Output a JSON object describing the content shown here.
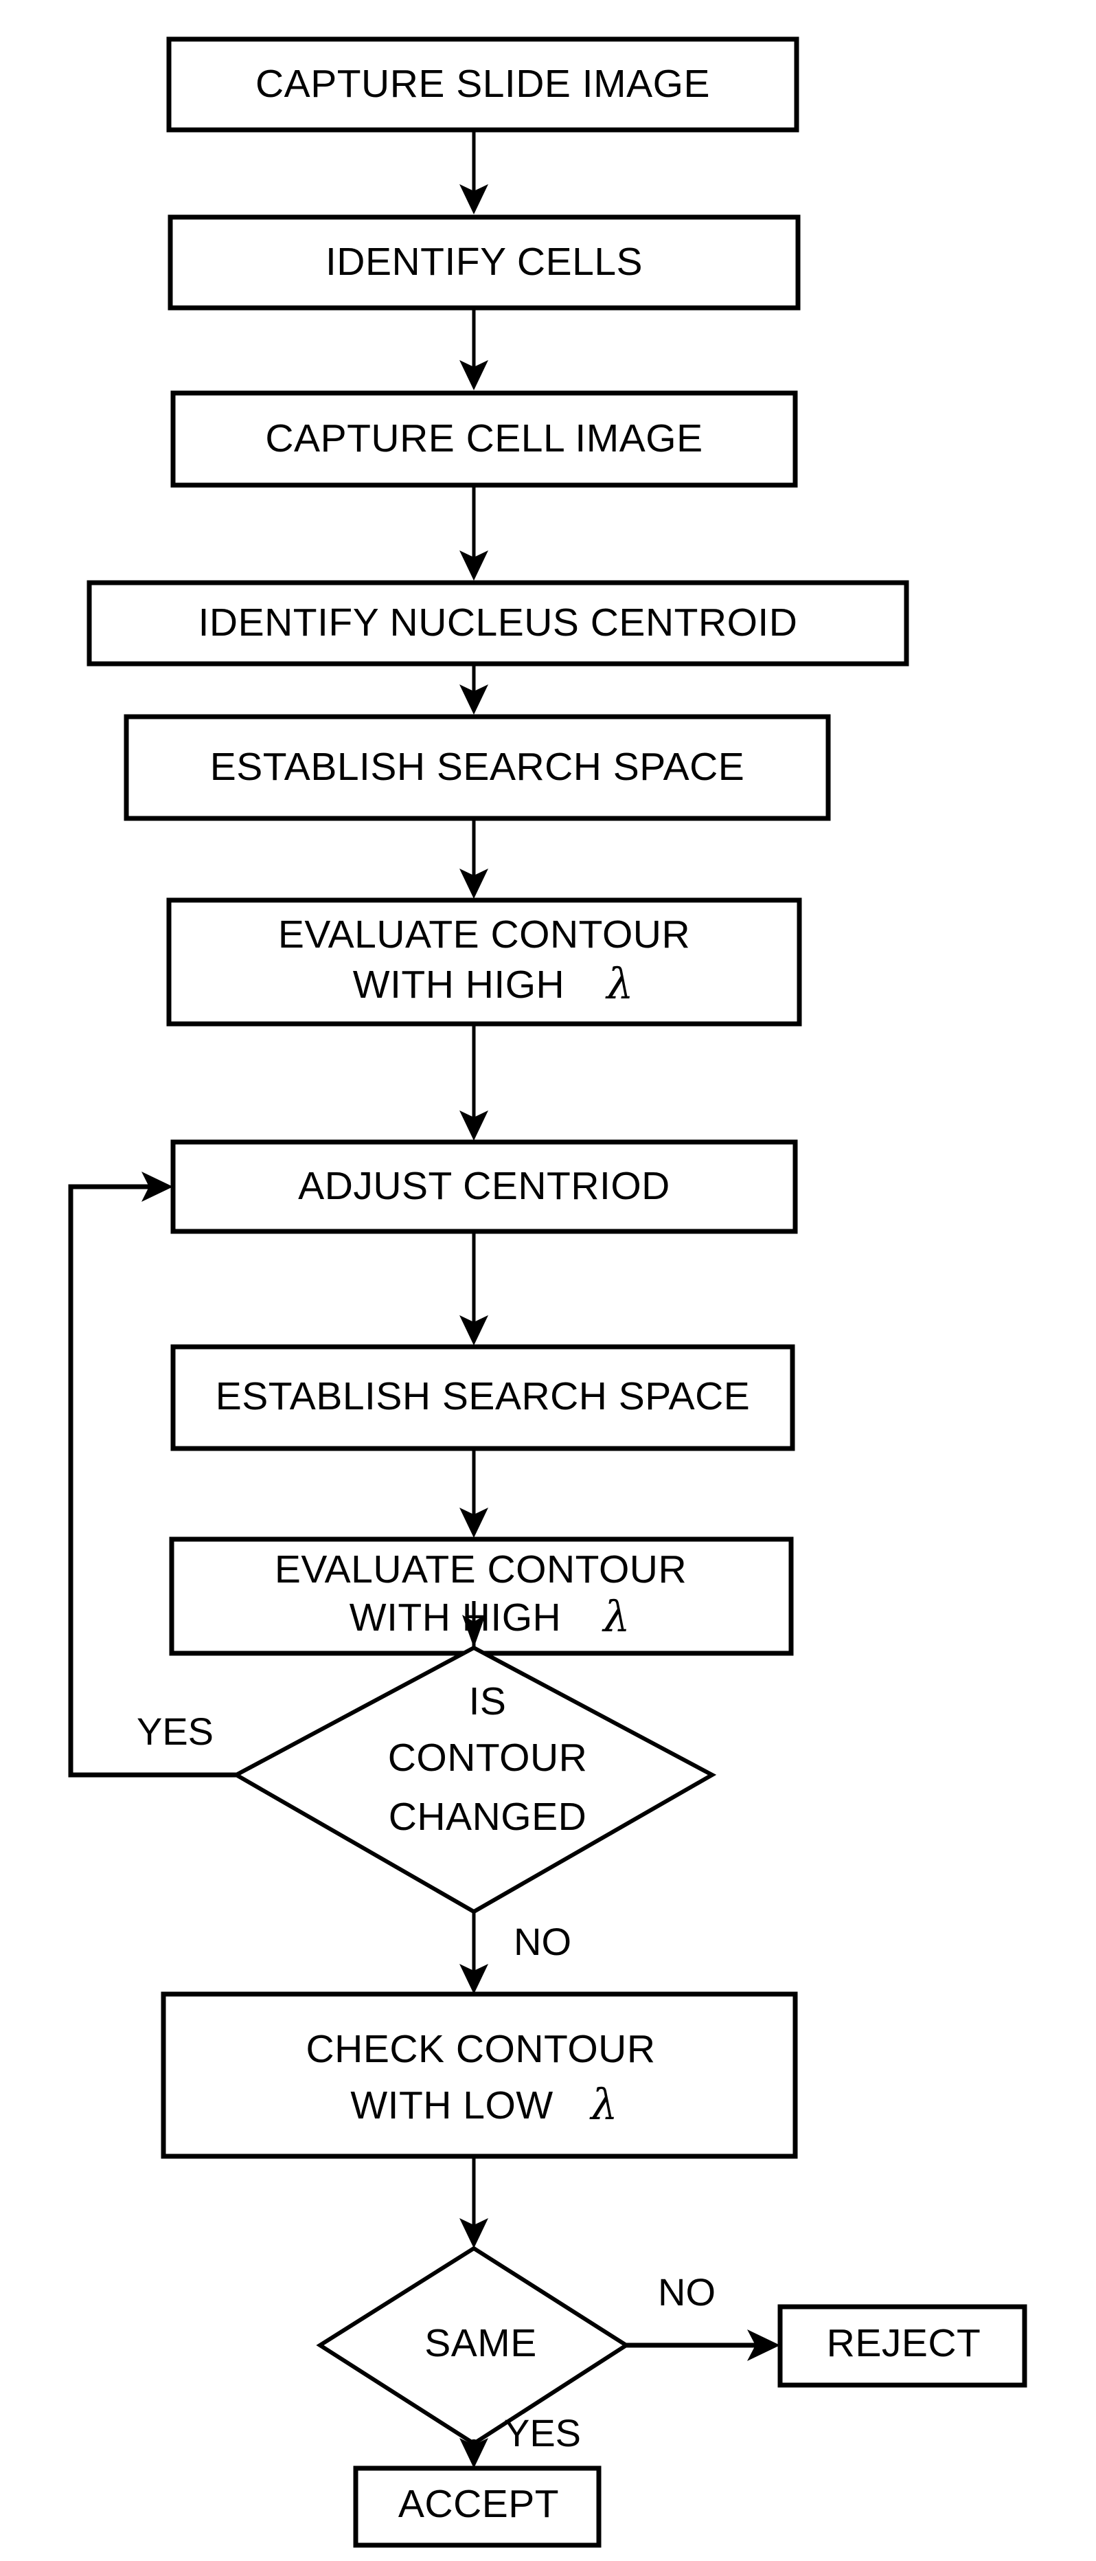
{
  "diagram": {
    "type": "flowchart",
    "title": "",
    "orientation": "top-to-bottom",
    "colors": {
      "background": "#ffffff",
      "stroke": "#000000",
      "fill": "#ffffff",
      "text": "#000000"
    },
    "nodes": [
      {
        "id": "n1",
        "shape": "process",
        "label": "CAPTURE SLIDE IMAGE"
      },
      {
        "id": "n2",
        "shape": "process",
        "label": "IDENTIFY CELLS"
      },
      {
        "id": "n3",
        "shape": "process",
        "label": "CAPTURE CELL IMAGE"
      },
      {
        "id": "n4",
        "shape": "process",
        "label": "IDENTIFY NUCLEUS CENTROID"
      },
      {
        "id": "n5",
        "shape": "process",
        "label": "ESTABLISH SEARCH SPACE"
      },
      {
        "id": "n6",
        "shape": "process",
        "label_line1": "EVALUATE CONTOUR",
        "label_line2": "WITH HIGH",
        "symbol": "λ"
      },
      {
        "id": "n7",
        "shape": "process",
        "label": "ADJUST CENTRIOD"
      },
      {
        "id": "n8",
        "shape": "process",
        "label": "ESTABLISH SEARCH SPACE"
      },
      {
        "id": "n9",
        "shape": "process",
        "label_line1": "EVALUATE CONTOUR",
        "label_line2": "WITH HIGH",
        "symbol": "λ"
      },
      {
        "id": "d1",
        "shape": "decision",
        "label_line1": "IS",
        "label_line2": "CONTOUR",
        "label_line3": "CHANGED"
      },
      {
        "id": "n10",
        "shape": "process",
        "label_line1": "CHECK CONTOUR",
        "label_line2": "WITH LOW",
        "symbol": "λ"
      },
      {
        "id": "d2",
        "shape": "decision",
        "label": "SAME"
      },
      {
        "id": "n11",
        "shape": "terminal",
        "label": "REJECT"
      },
      {
        "id": "n12",
        "shape": "terminal",
        "label": "ACCEPT"
      }
    ],
    "edge_labels": {
      "loop_yes": "YES",
      "contour_no": "NO",
      "same_no": "NO",
      "same_yes": "YES"
    },
    "edges": [
      {
        "from": "n1",
        "to": "n2",
        "label": ""
      },
      {
        "from": "n2",
        "to": "n3",
        "label": ""
      },
      {
        "from": "n3",
        "to": "n4",
        "label": ""
      },
      {
        "from": "n4",
        "to": "n5",
        "label": ""
      },
      {
        "from": "n5",
        "to": "n6",
        "label": ""
      },
      {
        "from": "n6",
        "to": "n7",
        "label": ""
      },
      {
        "from": "n7",
        "to": "n8",
        "label": ""
      },
      {
        "from": "n8",
        "to": "n9",
        "label": ""
      },
      {
        "from": "n9",
        "to": "d1",
        "label": ""
      },
      {
        "from": "d1",
        "to": "n7",
        "label": "YES"
      },
      {
        "from": "d1",
        "to": "n10",
        "label": "NO"
      },
      {
        "from": "n10",
        "to": "d2",
        "label": ""
      },
      {
        "from": "d2",
        "to": "n11",
        "label": "NO"
      },
      {
        "from": "d2",
        "to": "n12",
        "label": "YES"
      }
    ]
  }
}
